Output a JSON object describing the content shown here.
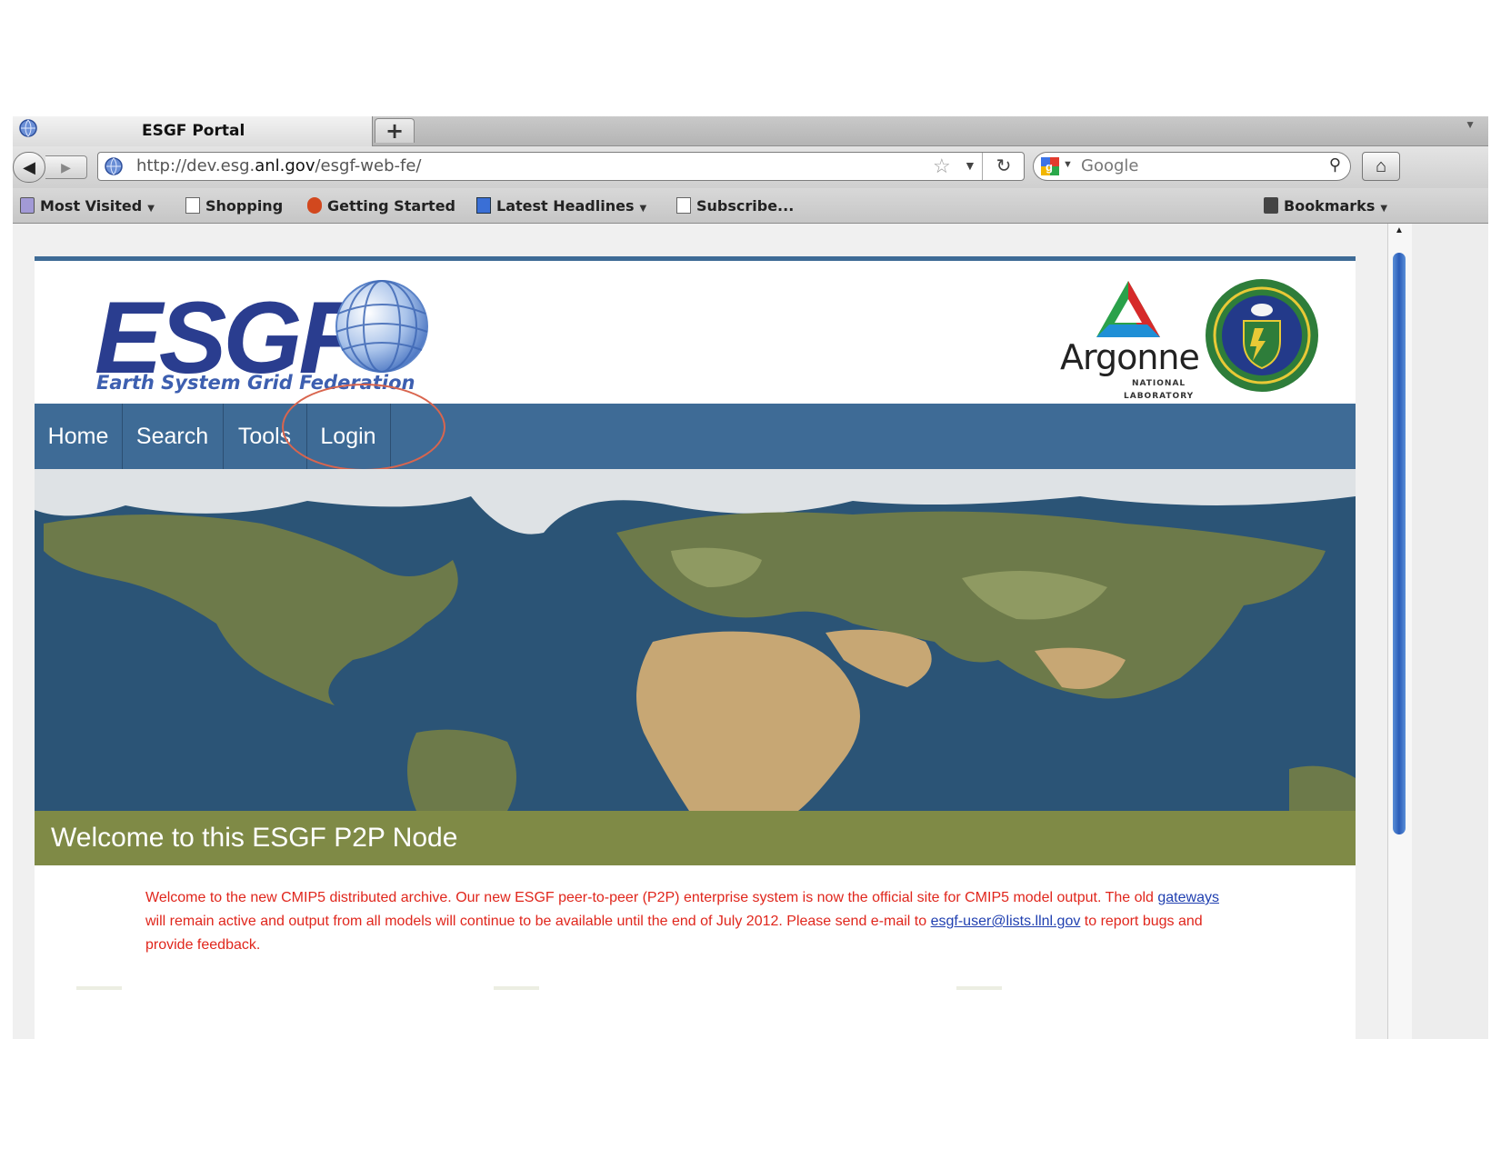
{
  "browser": {
    "tab_title": "ESGF Portal",
    "new_tab_label": "+",
    "url_prefix": "http://dev.esg.",
    "url_domain": "anl.gov",
    "url_suffix": "/esgf-web-fe/",
    "search_placeholder": "Google",
    "bookmarks": {
      "most_visited": "Most Visited",
      "shopping": "Shopping",
      "getting_started": "Getting Started",
      "latest_headlines": "Latest Headlines",
      "subscribe": "Subscribe...",
      "bookmarks": "Bookmarks"
    }
  },
  "site": {
    "logo_letters": "ESGF",
    "logo_subtitle": "Earth System Grid Federation",
    "argonne_name": "Argonne",
    "argonne_sub1": "NATIONAL",
    "argonne_sub2": "LABORATORY",
    "menu": {
      "home": "Home",
      "search": "Search",
      "tools": "Tools",
      "login": "Login"
    },
    "welcome_title": "Welcome to this ESGF P2P Node",
    "notice": {
      "part1": "Welcome to the new CMIP5 distributed archive. Our new ESGF peer-to-peer (P2P) enterprise system is now the official site for CMIP5 model output. The old ",
      "gateways_link": "gateways",
      "part2": " will remain active and output from all models will continue to be available until the end of July 2012. Please send e-mail to ",
      "email_link": "esgf-user@lists.llnl.gov",
      "part3": " to report bugs and provide feedback."
    }
  },
  "colors": {
    "menu_bg": "#3e6b96",
    "welcome_bg": "#7f8a46",
    "notice_text": "#e0261c",
    "annotation": "#d9654e"
  },
  "icons": [
    "globe-favicon",
    "back-arrow-icon",
    "forward-arrow-icon",
    "star-icon",
    "reload-icon",
    "google-icon",
    "search-icon",
    "home-icon"
  ]
}
